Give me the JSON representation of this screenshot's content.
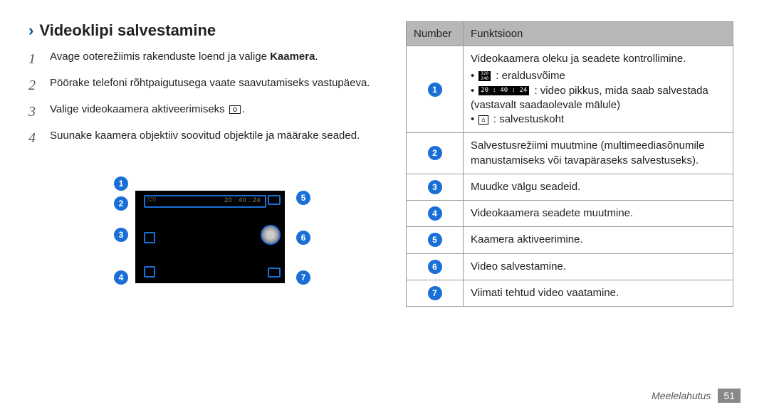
{
  "section": {
    "title": "Videoklipi salvestamine"
  },
  "steps": [
    {
      "num": "1",
      "text": "Avage ooterežiimis rakenduste loend ja valige ",
      "bold": "Kaamera",
      "suffix": "."
    },
    {
      "num": "2",
      "text": "Pöörake telefoni rõhtpaigutusega vaate saavutamiseks vastupäeva."
    },
    {
      "num": "3",
      "text": "Valige videokaamera aktiveerimiseks ",
      "icon": true,
      "suffix": "."
    },
    {
      "num": "4",
      "text": "Suunake kaamera objektiiv soovitud objektile ja määrake seaded."
    }
  ],
  "callouts": [
    "1",
    "2",
    "3",
    "4",
    "5",
    "6",
    "7"
  ],
  "screen": {
    "timecode": "20 : 40 : 24",
    "res_indicator": "320"
  },
  "table": {
    "headers": {
      "col1": "Number",
      "col2": "Funktsioon"
    },
    "rows": [
      {
        "num": "1",
        "main": "Videokaamera oleku ja seadete kontrollimine.",
        "items": [
          {
            "icon": "res",
            "text": ": eraldusvõime"
          },
          {
            "icon": "time",
            "text": ": video pikkus, mida saab salvestada (vastavalt saadaolevale mälule)"
          },
          {
            "icon": "disk",
            "text": ": salvestuskoht"
          }
        ]
      },
      {
        "num": "2",
        "main": "Salvestusrežiimi muutmine (multimeediasõnumile manustamiseks või tavapäraseks salvestuseks)."
      },
      {
        "num": "3",
        "main": "Muudke välgu seadeid."
      },
      {
        "num": "4",
        "main": "Videokaamera seadete muutmine."
      },
      {
        "num": "5",
        "main": "Kaamera aktiveerimine."
      },
      {
        "num": "6",
        "main": "Video salvestamine."
      },
      {
        "num": "7",
        "main": "Viimati tehtud video vaatamine."
      }
    ]
  },
  "footer": {
    "section": "Meelelahutus",
    "page": "51"
  },
  "icon_time_text": "20 : 40 : 24",
  "icon_res_text": "320\n240"
}
